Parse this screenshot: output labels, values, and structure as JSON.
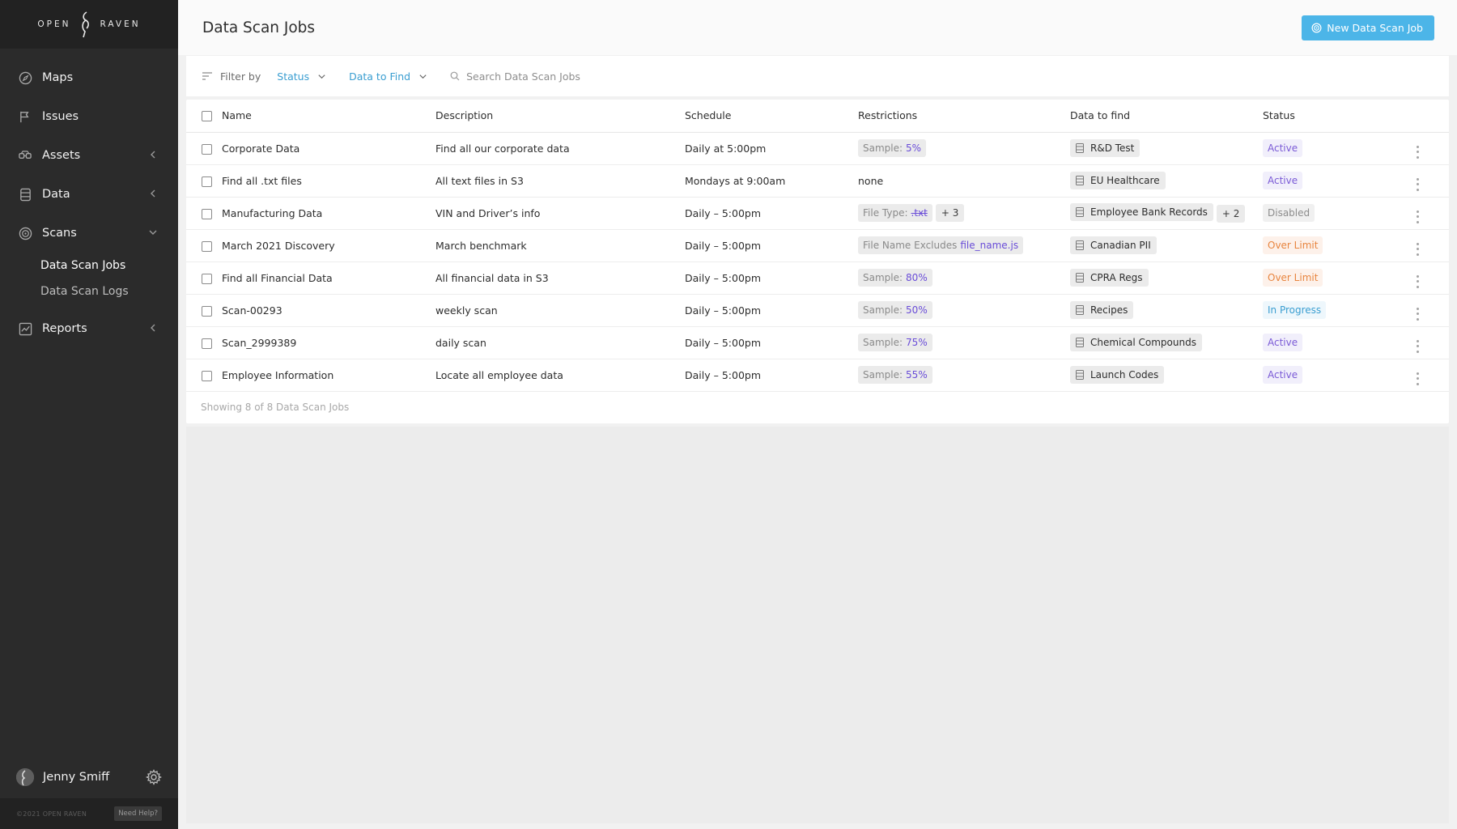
{
  "brand": {
    "left": "OPEN",
    "right": "RAVEN"
  },
  "nav": {
    "maps": "Maps",
    "issues": "Issues",
    "assets": "Assets",
    "data": "Data",
    "scans": "Scans",
    "scans_sub": [
      "Data Scan Jobs",
      "Data Scan Logs"
    ],
    "reports": "Reports"
  },
  "user": {
    "name": "Jenny Smiff"
  },
  "footer": {
    "copyright": "©2021 OPEN RAVEN",
    "help": "Need Help?"
  },
  "header": {
    "title": "Data Scan Jobs",
    "new_button": "New Data Scan Job"
  },
  "filters": {
    "label": "Filter by",
    "status": "Status",
    "data_to_find": "Data to Find",
    "search_placeholder": "Search Data Scan Jobs"
  },
  "table": {
    "columns": [
      "Name",
      "Description",
      "Schedule",
      "Restrictions",
      "Data to find",
      "Status"
    ],
    "rows": [
      {
        "name": "Corporate Data",
        "description": "Find all our corporate data",
        "schedule": "Daily at 5:00pm",
        "restriction_label": "Sample:",
        "restriction_value": "5%",
        "data": "R&D Test",
        "status": "Active"
      },
      {
        "name": "Find all .txt files",
        "description": "All text files in S3",
        "schedule": "Mondays at 9:00am",
        "restriction_text": "none",
        "data": "EU Healthcare",
        "status": "Active"
      },
      {
        "name": "Manufacturing Data",
        "description": "VIN and Driver’s info",
        "schedule": "Daily – 5:00pm",
        "restriction_label": "File Type:",
        "restriction_value": ".txt",
        "restriction_more": "+ 3",
        "data": "Employee Bank Records",
        "data_more": "+ 2",
        "status": "Disabled"
      },
      {
        "name": "March 2021 Discovery",
        "description": "March benchmark",
        "schedule": "Daily – 5:00pm",
        "restriction_label": "File Name Excludes",
        "restriction_value": "file_name.js",
        "data": "Canadian PII",
        "status": "Over Limit"
      },
      {
        "name": "Find all Financial Data",
        "description": "All financial data in S3",
        "schedule": "Daily – 5:00pm",
        "restriction_label": "Sample:",
        "restriction_value": "80%",
        "data": "CPRA Regs",
        "status": "Over Limit"
      },
      {
        "name": "Scan-00293",
        "description": "weekly scan",
        "schedule": "Daily – 5:00pm",
        "restriction_label": "Sample:",
        "restriction_value": "50%",
        "data": "Recipes",
        "status": "In Progress"
      },
      {
        "name": "Scan_2999389",
        "description": "daily scan",
        "schedule": "Daily – 5:00pm",
        "restriction_label": "Sample:",
        "restriction_value": "75%",
        "data": "Chemical Compounds",
        "status": "Active"
      },
      {
        "name": "Employee Information",
        "description": "Locate all employee data",
        "schedule": "Daily – 5:00pm",
        "restriction_label": "Sample:",
        "restriction_value": "55%",
        "data": "Launch Codes",
        "status": "Active"
      }
    ],
    "footer": "Showing 8 of 8 Data Scan Jobs"
  },
  "colors": {
    "sidebar_bg": "#2b2b2b",
    "accent_blue": "#4cb5e8",
    "status_active": "#7a5ad6",
    "status_over_limit": "#e8853f",
    "status_in_progress": "#3a9ed1",
    "status_disabled": "#8c8c8c"
  }
}
